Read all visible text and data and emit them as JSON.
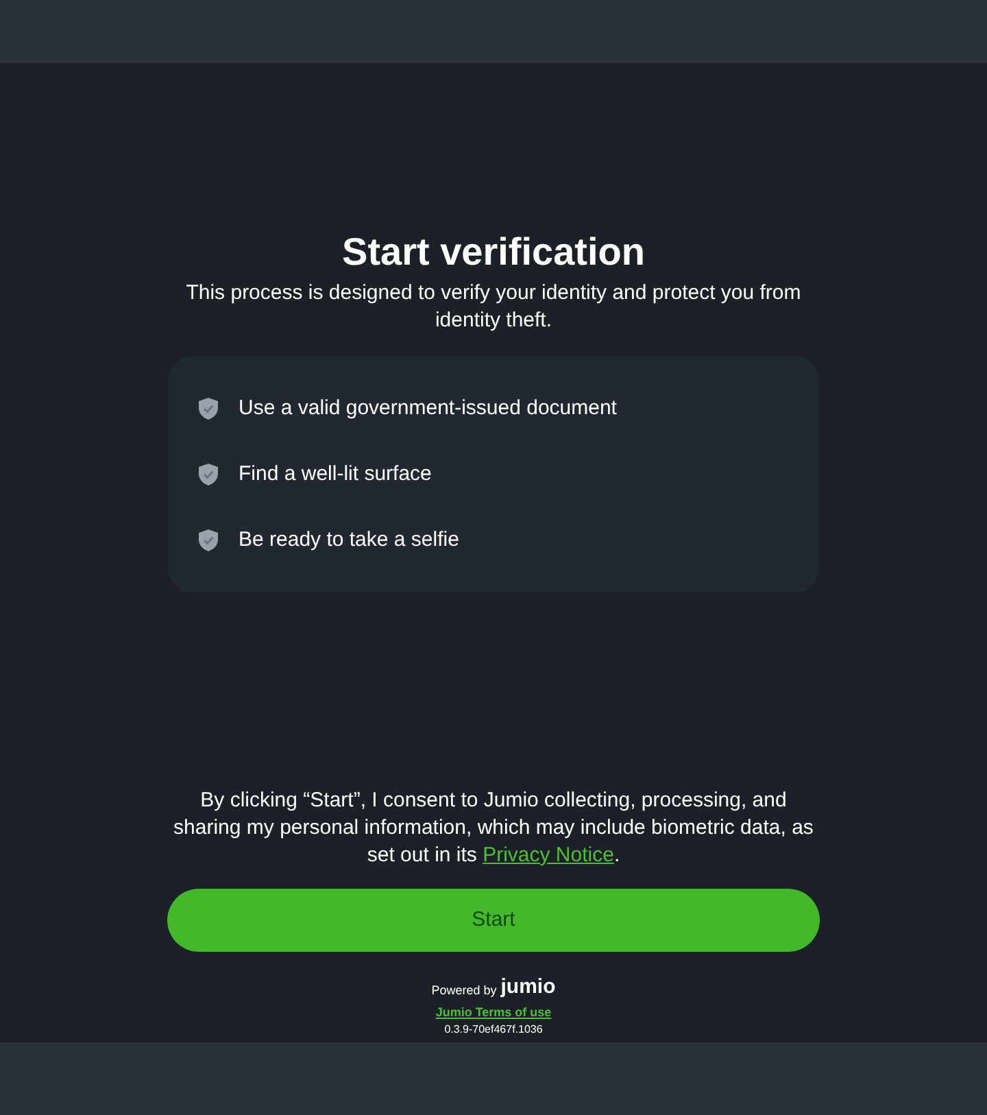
{
  "title": "Start verification",
  "subtitle": "This process is designed to verify your identity and protect you from identity theft.",
  "checklist": [
    "Use a valid government-issued document",
    "Find a well-lit surface",
    "Be ready to take a selfie"
  ],
  "consent": {
    "before": "By clicking “Start”, I consent to Jumio collecting, processing, and sharing my personal information, which may include biometric data, as set out in its ",
    "link": "Privacy Notice",
    "after": "."
  },
  "start_button": "Start",
  "footer": {
    "powered_by": "Powered by",
    "logo": "jumio",
    "terms_link": "Jumio Terms of use",
    "version": "0.3.9-70ef467f.1036"
  }
}
